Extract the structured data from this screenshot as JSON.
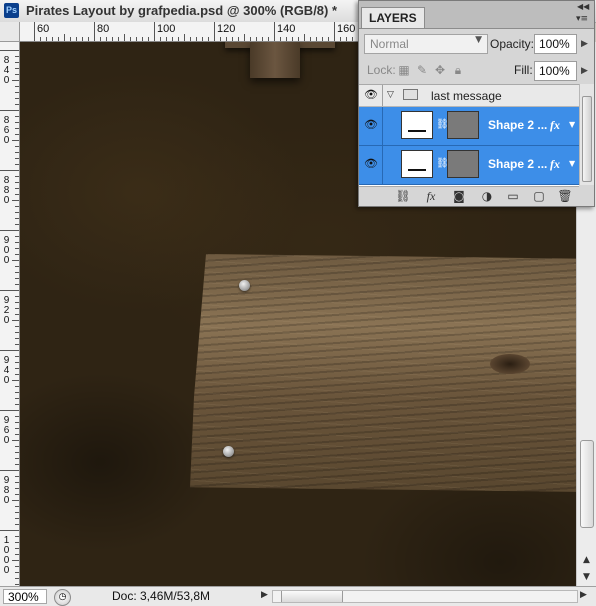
{
  "window": {
    "app_icon_label": "Ps",
    "title": "Pirates Layout by grafpedia.psd @ 300% (RGB/8) *"
  },
  "rulers": {
    "top_labels": [
      "60",
      "80",
      "100",
      "120",
      "140",
      "160"
    ],
    "left_labels": [
      "840",
      "860",
      "880",
      "900",
      "920",
      "940",
      "960",
      "980",
      "1000"
    ]
  },
  "status_bar": {
    "zoom": "300%",
    "doc_info": "Doc: 3,46M/53,8M"
  },
  "layers_panel": {
    "tab_label": "LAYERS",
    "blend_mode": "Normal",
    "opacity_label": "Opacity:",
    "opacity_value": "100%",
    "lock_label": "Lock:",
    "fill_label": "Fill:",
    "fill_value": "100%",
    "group": {
      "name": "last message",
      "visible": true,
      "expanded": true
    },
    "layers": [
      {
        "name": "Shape 2 ...",
        "fx": "fx",
        "visible": true,
        "selected": true
      },
      {
        "name": "Shape 2 ...",
        "fx": "fx",
        "visible": true,
        "selected": true
      }
    ],
    "selection_color": "#3d8ee8"
  },
  "icons": {
    "eye": "eye-icon",
    "folder": "folder-icon",
    "link": "link-layers-icon",
    "fx": "layer-style-icon",
    "mask": "add-mask-icon",
    "adjustment": "adjustment-layer-icon",
    "new_group": "new-group-icon",
    "new_layer": "new-layer-icon",
    "trash": "delete-layer-icon"
  }
}
